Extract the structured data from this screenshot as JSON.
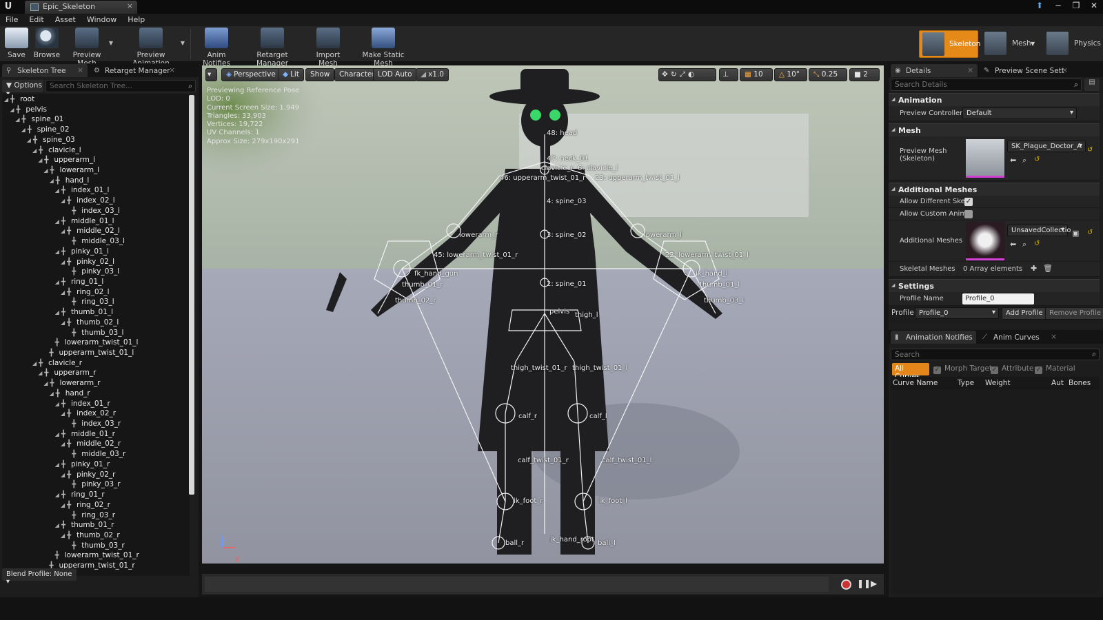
{
  "window": {
    "doc_tab": "Epic_Skeleton"
  },
  "menu": [
    "File",
    "Edit",
    "Asset",
    "Window",
    "Help"
  ],
  "toolbar": {
    "save": "Save",
    "browse": "Browse",
    "preview_mesh": "Preview Mesh",
    "preview_animation": "Preview Animation",
    "anim_notifies": "Anim Notifies",
    "retarget_manager": "Retarget Manager",
    "import_mesh": "Import Mesh",
    "make_static_mesh": "Make Static Mesh"
  },
  "modes": {
    "skeleton": "Skeleton",
    "mesh": "Mesh",
    "physics": "Physics"
  },
  "left_panel": {
    "tab_skeleton_tree": "Skeleton Tree",
    "tab_retarget_manager": "Retarget Manager",
    "options": "Options",
    "search_placeholder": "Search Skeleton Tree...",
    "blend_profile": "Blend Profile: None",
    "tree": [
      {
        "name": "root",
        "depth": 0
      },
      {
        "name": "pelvis",
        "depth": 1
      },
      {
        "name": "spine_01",
        "depth": 2
      },
      {
        "name": "spine_02",
        "depth": 3
      },
      {
        "name": "spine_03",
        "depth": 4
      },
      {
        "name": "clavicle_l",
        "depth": 5
      },
      {
        "name": "upperarm_l",
        "depth": 6
      },
      {
        "name": "lowerarm_l",
        "depth": 7
      },
      {
        "name": "hand_l",
        "depth": 8
      },
      {
        "name": "index_01_l",
        "depth": 9
      },
      {
        "name": "index_02_l",
        "depth": 10
      },
      {
        "name": "index_03_l",
        "depth": 11
      },
      {
        "name": "middle_01_l",
        "depth": 9
      },
      {
        "name": "middle_02_l",
        "depth": 10
      },
      {
        "name": "middle_03_l",
        "depth": 11
      },
      {
        "name": "pinky_01_l",
        "depth": 9
      },
      {
        "name": "pinky_02_l",
        "depth": 10
      },
      {
        "name": "pinky_03_l",
        "depth": 11
      },
      {
        "name": "ring_01_l",
        "depth": 9
      },
      {
        "name": "ring_02_l",
        "depth": 10
      },
      {
        "name": "ring_03_l",
        "depth": 11
      },
      {
        "name": "thumb_01_l",
        "depth": 9
      },
      {
        "name": "thumb_02_l",
        "depth": 10
      },
      {
        "name": "thumb_03_l",
        "depth": 11
      },
      {
        "name": "lowerarm_twist_01_l",
        "depth": 8
      },
      {
        "name": "upperarm_twist_01_l",
        "depth": 7
      },
      {
        "name": "clavicle_r",
        "depth": 5
      },
      {
        "name": "upperarm_r",
        "depth": 6
      },
      {
        "name": "lowerarm_r",
        "depth": 7
      },
      {
        "name": "hand_r",
        "depth": 8
      },
      {
        "name": "index_01_r",
        "depth": 9
      },
      {
        "name": "index_02_r",
        "depth": 10
      },
      {
        "name": "index_03_r",
        "depth": 11
      },
      {
        "name": "middle_01_r",
        "depth": 9
      },
      {
        "name": "middle_02_r",
        "depth": 10
      },
      {
        "name": "middle_03_r",
        "depth": 11
      },
      {
        "name": "pinky_01_r",
        "depth": 9
      },
      {
        "name": "pinky_02_r",
        "depth": 10
      },
      {
        "name": "pinky_03_r",
        "depth": 11
      },
      {
        "name": "ring_01_r",
        "depth": 9
      },
      {
        "name": "ring_02_r",
        "depth": 10
      },
      {
        "name": "ring_03_r",
        "depth": 11
      },
      {
        "name": "thumb_01_r",
        "depth": 9
      },
      {
        "name": "thumb_02_r",
        "depth": 10
      },
      {
        "name": "thumb_03_r",
        "depth": 11
      },
      {
        "name": "lowerarm_twist_01_r",
        "depth": 8
      },
      {
        "name": "upperarm_twist_01_r",
        "depth": 7
      }
    ]
  },
  "viewport": {
    "view_mode": "Perspective",
    "lit": "Lit",
    "show": "Show",
    "character": "Character",
    "lod": "LOD Auto",
    "speed": "x1.0",
    "grid_snap": "10",
    "rot_snap": "10°",
    "scale_snap": "0.25",
    "camera_speed": "2",
    "info": [
      "Previewing Reference Pose",
      "LOD: 0",
      "Current Screen Size: 1.949",
      "Triangles: 33,903",
      "Vertices: 19,722",
      "UV Channels: 1",
      "Approx Size: 279x190x291"
    ],
    "bone_labels": [
      "48: head",
      "47: neck_01",
      "6: clavicle_l",
      "clavicle_r",
      "46: upperarm_twist_01_r",
      "23: upperarm_twist_01_l",
      "4: spine_03",
      "lowerarm_r",
      "lowerarm_l",
      "3: spine_02",
      "45: lowerarm_twist_01_r",
      "22: lowerarm_twist_01_l",
      "fk_hand_gun",
      "ik_hand_l",
      "2: spine_01",
      "thumb_01_r",
      "thumb_01_l",
      "thumb_02_r",
      "thumb_03_l",
      "pelvis",
      "thigh_l",
      "thigh_twist_01_r",
      "thigh_twist_01_l",
      "calf_r",
      "calf_l",
      "calf_twist_01_r",
      "calf_twist_01_l",
      "ik_foot_r",
      "ik_foot_l",
      "ball_r",
      "ball_l",
      "ik_hand_root"
    ]
  },
  "details": {
    "tab_details": "Details",
    "tab_preview_scene": "Preview Scene Sett",
    "search_placeholder": "Search Details",
    "cat_animation": "Animation",
    "preview_controller_label": "Preview Controller",
    "preview_controller_value": "Default",
    "cat_mesh": "Mesh",
    "preview_mesh_label": "Preview Mesh (Skeleton)",
    "preview_mesh_value": "SK_Plague_Doctor_A",
    "cat_additional_meshes": "Additional Meshes",
    "allow_diff_skel_label": "Allow Different Skele",
    "allow_custom_anim_label": "Allow Custom AnimB",
    "additional_meshes_label": "Additional Meshes",
    "additional_meshes_value": "UnsavedCollectio",
    "skeletal_meshes_label": "Skeletal Meshes",
    "skeletal_meshes_value": "0 Array elements",
    "cat_settings": "Settings",
    "profile_name_label": "Profile Name",
    "profile_name_value": "Profile_0",
    "profile_label": "Profile",
    "profile_value": "Profile_0",
    "add_profile": "Add Profile",
    "remove_profile": "Remove Profile"
  },
  "curves": {
    "tab_anim_notifies": "Animation Notifies",
    "tab_anim_curves": "Anim Curves",
    "search_placeholder": "Search",
    "all_curves": "All Curves",
    "morph_target": "Morph Target",
    "attribute": "Attribute",
    "material": "Material",
    "col_name": "Curve Name",
    "col_type": "Type",
    "col_weight": "Weight",
    "col_auto": "Aut",
    "col_bones": "Bones"
  }
}
